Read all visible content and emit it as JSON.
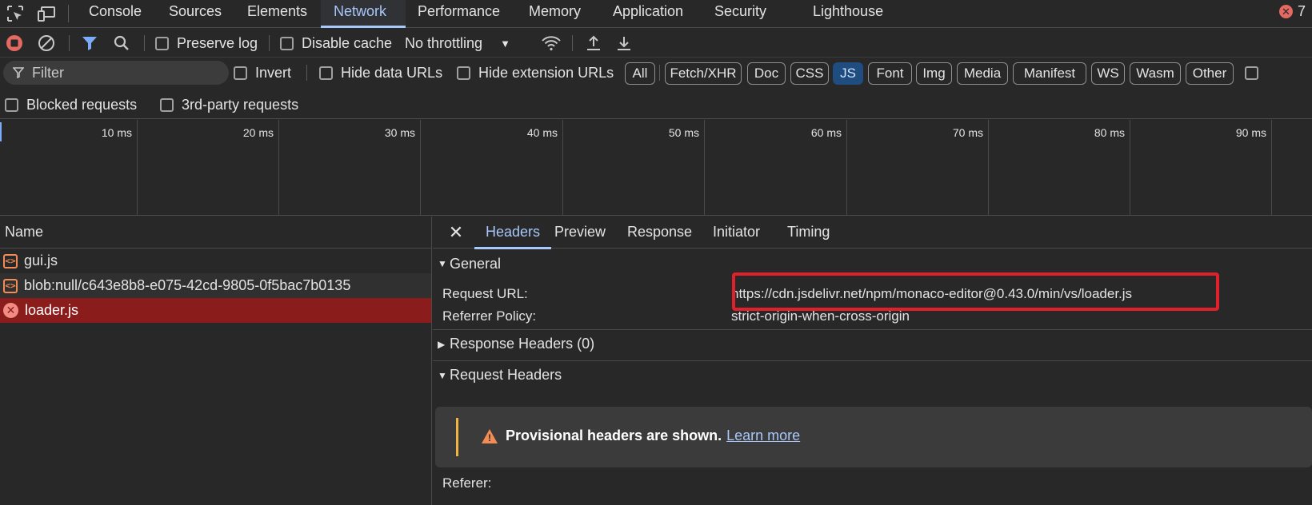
{
  "tabbar": {
    "tabs": [
      {
        "label": "Console"
      },
      {
        "label": "Sources"
      },
      {
        "label": "Elements"
      },
      {
        "label": "Network"
      },
      {
        "label": "Performance"
      },
      {
        "label": "Memory"
      },
      {
        "label": "Application"
      },
      {
        "label": "Security"
      },
      {
        "label": "Lighthouse"
      }
    ],
    "active_tab": "Network",
    "error_count": "7"
  },
  "toolbar": {
    "preserve_log": "Preserve log",
    "disable_cache": "Disable cache",
    "throttling": "No throttling"
  },
  "filter": {
    "placeholder": "Filter",
    "invert": "Invert",
    "hide_data_urls": "Hide data URLs",
    "hide_extension_urls": "Hide extension URLs",
    "types": [
      "All",
      "Fetch/XHR",
      "Doc",
      "CSS",
      "JS",
      "Font",
      "Img",
      "Media",
      "Manifest",
      "WS",
      "Wasm",
      "Other"
    ],
    "active_type": "JS",
    "blocked_requests": "Blocked requests",
    "third_party_requests": "3rd-party requests"
  },
  "timeline": {
    "ticks": [
      "10 ms",
      "20 ms",
      "30 ms",
      "40 ms",
      "50 ms",
      "60 ms",
      "70 ms",
      "80 ms",
      "90 ms"
    ]
  },
  "request_list": {
    "header": "Name",
    "rows": [
      {
        "name": "gui.js",
        "status": "ok"
      },
      {
        "name": "blob:null/c643e8b8-e075-42cd-9805-0f5bac7b0135",
        "status": "ok"
      },
      {
        "name": "loader.js",
        "status": "error"
      }
    ]
  },
  "detail": {
    "tabs": [
      "Headers",
      "Preview",
      "Response",
      "Initiator",
      "Timing"
    ],
    "active_tab": "Headers",
    "general": {
      "title": "General",
      "request_url_label": "Request URL:",
      "request_url_value": "https://cdn.jsdelivr.net/npm/monaco-editor@0.43.0/min/vs/loader.js",
      "referrer_policy_label": "Referrer Policy:",
      "referrer_policy_value": "strict-origin-when-cross-origin"
    },
    "response_headers": "Response Headers (0)",
    "request_headers": "Request Headers",
    "warning": {
      "text": "Provisional headers are shown.",
      "link": "Learn more"
    },
    "referer_label": "Referer:"
  },
  "colors": {
    "accent": "#a8c7fa",
    "error_row": "#8a1c1c",
    "highlight_box": "#e0202a",
    "warning": "#f2b440"
  }
}
